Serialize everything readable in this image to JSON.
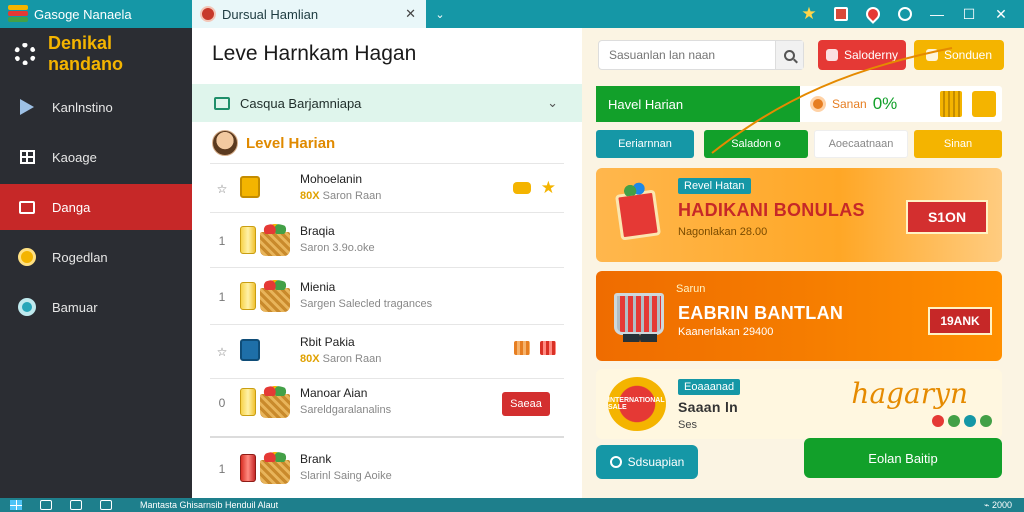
{
  "titlebar": {
    "app_name": "Gasoge Nanaela",
    "tab_label": "Dursual Hamlian",
    "tab_close": "✕",
    "new_tab": "⌄",
    "window_controls": {
      "minimize": "—",
      "maximize": "☐",
      "close": "✕"
    }
  },
  "sidebar": {
    "title": "Denikal nandano",
    "items": [
      {
        "label": "Kanlnstino",
        "icon": "share-icon",
        "active": false
      },
      {
        "label": "Kaoage",
        "icon": "grid-icon",
        "active": false
      },
      {
        "label": "Danga",
        "icon": "card-icon",
        "active": true
      },
      {
        "label": "Rogedlan",
        "icon": "coin-icon",
        "active": false
      },
      {
        "label": "Bamuar",
        "icon": "ring-icon",
        "active": false
      }
    ]
  },
  "middle": {
    "title": "Leve Harnkam Hagan",
    "subheader": "Casqua Barjamniapa",
    "subheader_more": "⌄",
    "level_label": "Level Harian",
    "items": [
      {
        "rank": "☆",
        "name": "Mohoelanin",
        "sub_highlight": "80X",
        "sub": "Saron Raan",
        "thumb": "gold"
      },
      {
        "rank": "1",
        "name": "Braqia",
        "sub_highlight": "",
        "sub": "Saron 3.9o.oke",
        "thumb": "basket"
      },
      {
        "rank": "1",
        "name": "Mienia",
        "sub_highlight": "",
        "sub": "Sargen Salecled tragances",
        "thumb": "basket"
      },
      {
        "rank": "☆",
        "name": "Rbit Pakia",
        "sub_highlight": "80X",
        "sub": "Saron Raan",
        "thumb": "blue"
      },
      {
        "rank": "0",
        "name": "Manoar Aian",
        "sub_highlight": "",
        "sub": "Sareldgaralanalins",
        "thumb": "basket",
        "button": "Saeaa"
      },
      {
        "rank": "1",
        "name": "Brank",
        "sub_highlight": "",
        "sub": "Slarinl Saing Aoike",
        "thumb": "red"
      }
    ]
  },
  "right": {
    "search_placeholder": "Sasuanlan lan naan",
    "top_buttons": {
      "red": "Saloderny",
      "yellow": "Sonduen"
    },
    "green_tab": "Havel Harian",
    "green_right_label": "Sanan",
    "green_right_pct": "0%",
    "pills": [
      "Eeriarnnan",
      "Saladon o",
      "Aoecaatnaan",
      "Sinan"
    ],
    "cards": [
      {
        "chip": "Revel Hatan",
        "title": "HADIKANI BONULAS",
        "sub": "Nagonlakan 28.00",
        "button": "S1ON"
      },
      {
        "chip": "Sarun",
        "title": "EABRIN BANTLAN",
        "sub": "Kaanerlakan 29400",
        "button": "19ANK"
      },
      {
        "chip": "Eoaaanad",
        "title": "Saaan ln",
        "sub": "Ses",
        "badge": "INTERNATIONAL SALE",
        "signature": "hagaryn"
      }
    ],
    "bottom_buttons": {
      "teal": "Sdsuapian",
      "green": "Eolan Baitip"
    }
  },
  "taskbar": {
    "text": "Mantasta Ghisarnsib Henduil Alaut",
    "tray": "⌁ 2000"
  },
  "colors": {
    "accent_teal": "#1597a6",
    "sidebar_bg": "#2b2d33",
    "active_red": "#c62828",
    "brand_yellow": "#f4b400",
    "brand_green": "#12a02a",
    "panel_cream": "#fbf4e3"
  }
}
